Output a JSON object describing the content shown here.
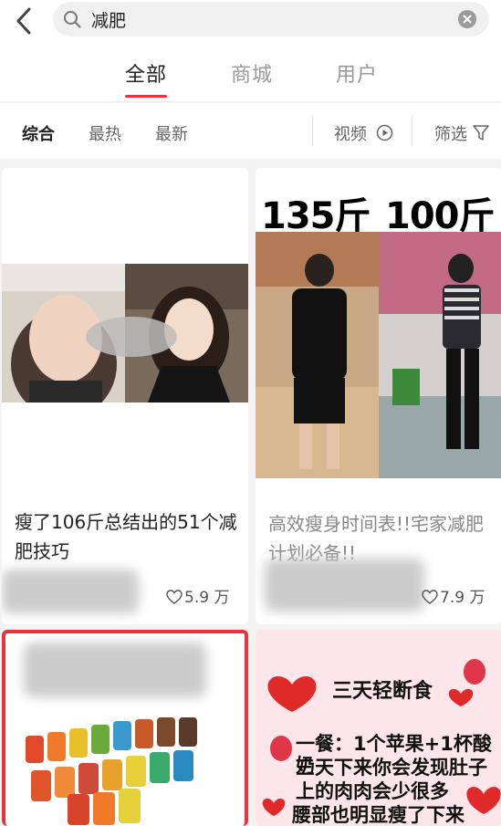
{
  "search": {
    "query": "减肥"
  },
  "tabs": [
    {
      "label": "全部"
    },
    {
      "label": "商城"
    },
    {
      "label": "用户"
    }
  ],
  "sort": {
    "comprehensive": "综合",
    "hottest": "最热",
    "newest": "最新",
    "video": "视频",
    "filter": "筛选"
  },
  "cards": [
    {
      "title": "瘦了106斤总结出的51个减肥技巧",
      "likes": "5.9 万"
    },
    {
      "headline_left": "135斤",
      "headline_right": "100斤",
      "title": "高效瘦身时间表!!宅家减肥计划必备!!",
      "likes": "7.9 万"
    },
    {
      "caption": ""
    },
    {
      "title": "三天轻断食",
      "line1": "一餐：1个苹果+1杯酸奶",
      "line2": "三天下来你会发现肚子",
      "line3": "上的肉肉会少很多",
      "line4": "腰部也明显瘦了下来"
    }
  ],
  "colors": {
    "accent": "#e8323c",
    "card4_bg": "#fde6ea",
    "card3_border": "#e8323c"
  }
}
